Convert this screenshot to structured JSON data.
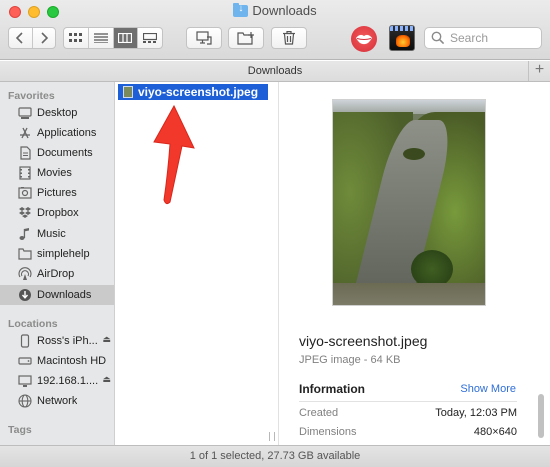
{
  "window": {
    "title": "Downloads"
  },
  "toolbar": {
    "search_placeholder": "Search",
    "back_icon": "chevron-left-icon",
    "forward_icon": "chevron-right-icon"
  },
  "pathbar": {
    "label": "Downloads",
    "add": "+"
  },
  "sidebar": {
    "favorites_header": "Favorites",
    "favorites": [
      {
        "label": "Desktop",
        "icon": "desktop-icon"
      },
      {
        "label": "Applications",
        "icon": "applications-icon"
      },
      {
        "label": "Documents",
        "icon": "documents-icon"
      },
      {
        "label": "Movies",
        "icon": "movies-icon"
      },
      {
        "label": "Pictures",
        "icon": "pictures-icon"
      },
      {
        "label": "Dropbox",
        "icon": "dropbox-icon"
      },
      {
        "label": "Music",
        "icon": "music-icon"
      },
      {
        "label": "simplehelp",
        "icon": "home-folder-icon"
      },
      {
        "label": "AirDrop",
        "icon": "airdrop-icon"
      },
      {
        "label": "Downloads",
        "icon": "downloads-icon",
        "selected": true
      }
    ],
    "locations_header": "Locations",
    "locations": [
      {
        "label": "Ross's iPh...",
        "icon": "iphone-icon",
        "eject": "⏏"
      },
      {
        "label": "Macintosh HD",
        "icon": "hard-drive-icon"
      },
      {
        "label": "192.168.1....",
        "icon": "network-drive-icon",
        "eject": "⏏"
      },
      {
        "label": "Network",
        "icon": "network-icon"
      }
    ],
    "tags_header": "Tags"
  },
  "column": {
    "selected_file": "viyo-screenshot.jpeg"
  },
  "preview": {
    "filename": "viyo-screenshot.jpeg",
    "subtitle": "JPEG image - 64 KB",
    "info_header": "Information",
    "show_more": "Show More",
    "rows": [
      {
        "key": "Created",
        "value": "Today, 12:03 PM"
      },
      {
        "key": "Dimensions",
        "value": "480×640"
      }
    ]
  },
  "status": {
    "text": "1 of 1 selected, 27.73 GB available"
  },
  "colors": {
    "selection": "#1d5fd6",
    "arrow": "#f2382b",
    "link": "#2f6fd8"
  }
}
